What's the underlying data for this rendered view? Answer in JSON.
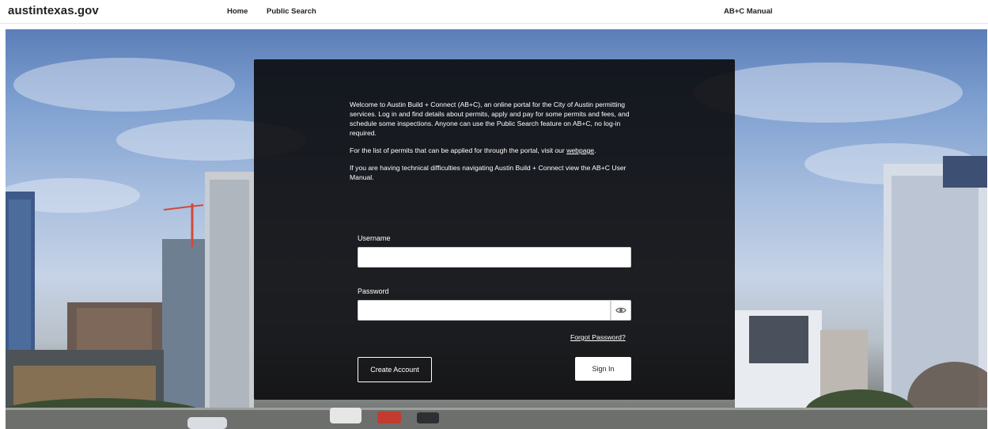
{
  "header": {
    "brand": "austintexas.gov",
    "nav": {
      "home": "Home",
      "public_search": "Public Search",
      "manual": "AB+C Manual"
    }
  },
  "login": {
    "intro_1": "Welcome to Austin Build + Connect (AB+C), an online portal for the City of Austin permitting services. Log in and find details about permits, apply and pay for some permits and fees, and schedule some inspections. Anyone can use the Public Search feature on AB+C, no log-in required.",
    "intro_2_prefix": "For the list of permits that can be applied for through the portal, visit our ",
    "intro_2_link": "webpage",
    "intro_2_suffix": ".",
    "intro_3": "If you are having technical difficulties navigating Austin Build + Connect view the AB+C User Manual.",
    "username_label": "Username",
    "username_value": "",
    "password_label": "Password",
    "password_value": "",
    "show_password_icon": "eye-icon",
    "forgot_password": "Forgot Password?",
    "create_account": "Create Account",
    "sign_in": "Sign In"
  },
  "colors": {
    "panel_bg": "#0a0a0c",
    "text_on_panel": "#ffffff",
    "nav_text": "#222222"
  }
}
